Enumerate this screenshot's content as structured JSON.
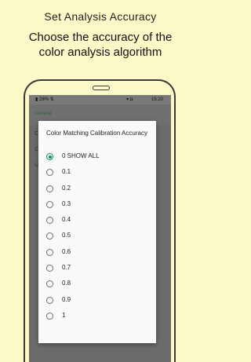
{
  "promo": {
    "title": "Set Analysis Accuracy",
    "subtitle_line1": "Choose the accuracy of the",
    "subtitle_line2": "color analysis algorithm"
  },
  "statusbar": {
    "battery": "28%",
    "time": "15:20"
  },
  "appbar": {
    "label": "General"
  },
  "dialog": {
    "title": "Color Matching Calibration Accuracy",
    "selected_index": 0,
    "options": [
      {
        "label": "0 SHOW ALL"
      },
      {
        "label": "0.1"
      },
      {
        "label": "0.2"
      },
      {
        "label": "0.3"
      },
      {
        "label": "0.4"
      },
      {
        "label": "0.5"
      },
      {
        "label": "0.6"
      },
      {
        "label": "0.7"
      },
      {
        "label": "0.8"
      },
      {
        "label": "0.9"
      },
      {
        "label": "1"
      }
    ]
  },
  "colors": {
    "background": "#fcf9c8",
    "accent": "#0f8a73"
  }
}
